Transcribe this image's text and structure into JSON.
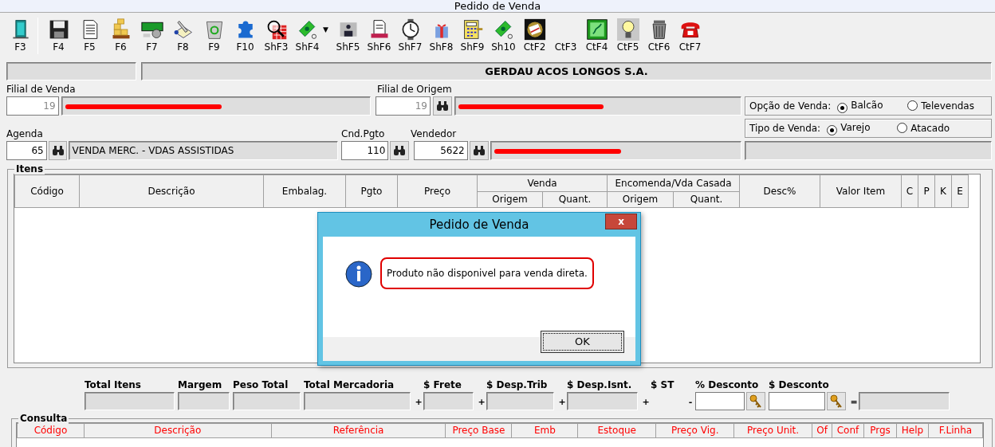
{
  "window": {
    "title": "Pedido de Venda"
  },
  "toolbar": [
    {
      "label": "F3",
      "kind": "door",
      "separator": true
    },
    {
      "label": "F4",
      "kind": "disk"
    },
    {
      "label": "F5",
      "kind": "document"
    },
    {
      "label": "F6",
      "kind": "boxes"
    },
    {
      "label": "F7",
      "kind": "money"
    },
    {
      "label": "F8",
      "kind": "pen"
    },
    {
      "label": "F9",
      "kind": "recycle"
    },
    {
      "label": "F10",
      "kind": "puzzle"
    },
    {
      "label": "ShF3",
      "kind": "magnifier"
    },
    {
      "label": "ShF4",
      "kind": "cash",
      "dropdown": "▼"
    },
    {
      "label": "ShF5",
      "kind": "person"
    },
    {
      "label": "ShF6",
      "kind": "printer"
    },
    {
      "label": "ShF7",
      "kind": "clock"
    },
    {
      "label": "ShF8",
      "kind": "gift"
    },
    {
      "label": "ShF9",
      "kind": "calculator"
    },
    {
      "label": "Sh10",
      "kind": "cash"
    },
    {
      "label": "CtF2",
      "kind": "monitor"
    },
    {
      "label": "CtF3",
      "kind": "blank"
    },
    {
      "label": "CtF4",
      "kind": "picture"
    },
    {
      "label": "CtF5",
      "kind": "bulb"
    },
    {
      "label": "CtF6",
      "kind": "trash"
    },
    {
      "label": "CtF7",
      "kind": "phone"
    }
  ],
  "company": "GERDAU ACOS LONGOS S.A.",
  "filial_venda": {
    "label": "Filial de Venda",
    "code": "19",
    "code_disabled": true,
    "name_redacted": true
  },
  "filial_origem": {
    "label": "Filial de Origem",
    "code": "19",
    "code_disabled": true,
    "name_redacted": true
  },
  "agenda": {
    "label": "Agenda",
    "code": "65",
    "name": "VENDA MERC. - VDAS ASSISTIDAS"
  },
  "cnd_pgto": {
    "label": "Cnd.Pgto",
    "code": "110"
  },
  "vendedor": {
    "label": "Vendedor",
    "code": "5622",
    "name_redacted": true
  },
  "radio_groups": [
    {
      "label": "Opção de Venda:",
      "options": [
        {
          "label": "Balcão",
          "selected": true
        },
        {
          "label": "Televendas",
          "selected": false
        }
      ]
    },
    {
      "label": "Tipo de Venda:",
      "options": [
        {
          "label": "Varejo",
          "selected": true
        },
        {
          "label": "Atacado",
          "selected": false
        }
      ]
    }
  ],
  "items": {
    "title": "Itens",
    "columns": [
      {
        "label": "Código"
      },
      {
        "label": "Descrição"
      },
      {
        "label": "Embalag."
      },
      {
        "label": "Pgto"
      },
      {
        "label": "Preço"
      },
      {
        "label": "Venda",
        "children": [
          {
            "label": "Origem"
          },
          {
            "label": "Quant."
          }
        ]
      },
      {
        "label": "Encomenda/Vda Casada",
        "children": [
          {
            "label": "Origem"
          },
          {
            "label": "Quant."
          }
        ]
      },
      {
        "label": "Desc%"
      },
      {
        "label": "Valor Item"
      },
      {
        "label": "C"
      },
      {
        "label": "P"
      },
      {
        "label": "K"
      },
      {
        "label": "E"
      }
    ]
  },
  "dialog": {
    "title": "Pedido de Venda",
    "close": "x",
    "message": "Produto não disponivel para venda direta.",
    "button": "OK"
  },
  "totals": [
    {
      "label": "Total Itens",
      "kind": "readonly"
    },
    {
      "label": "Margem",
      "kind": "readonly"
    },
    {
      "label": "Peso Total",
      "kind": "readonly"
    },
    {
      "label": "Total Mercadoria",
      "kind": "readonly"
    },
    {
      "operator": "+"
    },
    {
      "label": "$ Frete",
      "kind": "readonly"
    },
    {
      "operator": "+"
    },
    {
      "label": "$ Desp.Trib",
      "kind": "readonly"
    },
    {
      "operator": "+"
    },
    {
      "label": "$ Desp.Isnt.",
      "kind": "readonly"
    },
    {
      "operator": "+"
    },
    {
      "label": "$ ST",
      "kind": "label"
    },
    {
      "operator": "-"
    },
    {
      "label": "% Desconto",
      "kind": "input"
    },
    {
      "label": "$ Desconto",
      "kind": "input"
    },
    {
      "operator": "="
    },
    {
      "kind": "readonly"
    }
  ],
  "consulta": {
    "title": "Consulta",
    "columns": [
      "Código",
      "Descrição",
      "Referência",
      "Preço Base",
      "Emb",
      "Estoque",
      "Preço Vig.",
      "Preço Unit.",
      "Of",
      "Conf",
      "Prgs",
      "Help",
      "F.Linha"
    ]
  }
}
